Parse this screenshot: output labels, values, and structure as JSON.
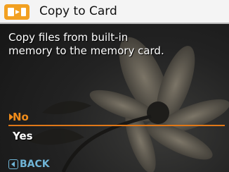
{
  "header": {
    "title": "Copy to Card",
    "icon": "memory-card-copy-icon"
  },
  "message": "Copy files from built-in\nmemory to the memory card.",
  "options": [
    {
      "label": "No",
      "selected": true
    },
    {
      "label": "Yes",
      "selected": false
    }
  ],
  "footer": {
    "back_label": "BACK",
    "back_icon": "back-arrow-icon"
  },
  "colors": {
    "accent": "#f08c1a",
    "back": "#6fb4d6",
    "titlebar": "#f4f4f4"
  }
}
